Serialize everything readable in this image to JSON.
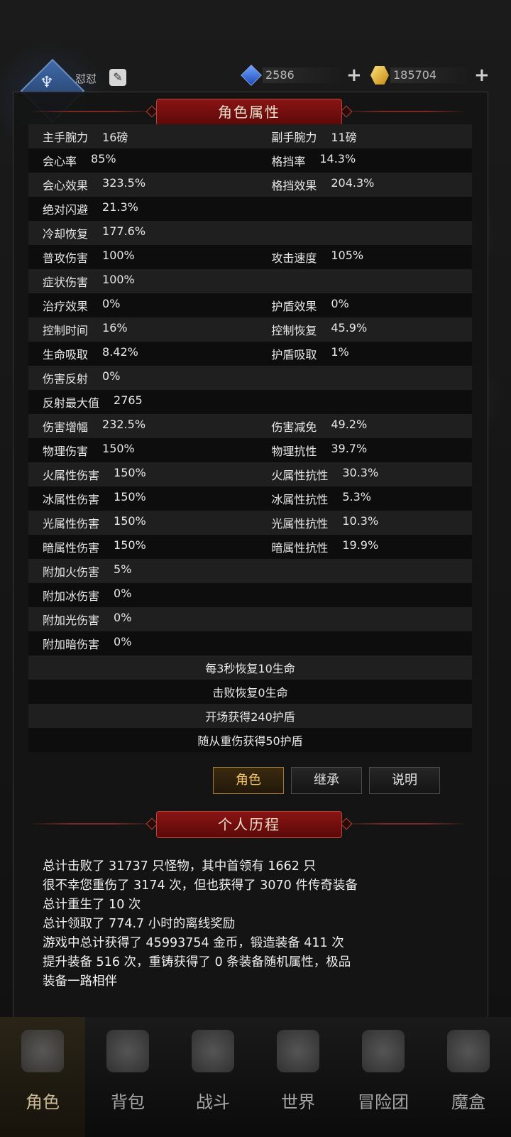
{
  "header": {
    "player_name": "怼怼",
    "currencies": [
      {
        "icon": "blue-gem-icon",
        "value": "2586"
      },
      {
        "icon": "gold-crystal-icon",
        "value": "185704"
      }
    ]
  },
  "attributes_panel": {
    "title": "角色属性",
    "rows": [
      {
        "l_label": "主手腕力",
        "l_value": "16磅",
        "r_label": "副手腕力",
        "r_value": "11磅"
      },
      {
        "l_label": "会心率",
        "l_value": "85%",
        "r_label": "格挡率",
        "r_value": "14.3%"
      },
      {
        "l_label": "会心效果",
        "l_value": "323.5%",
        "r_label": "格挡效果",
        "r_value": "204.3%"
      },
      {
        "l_label": "绝对闪避",
        "l_value": "21.3%",
        "r_label": "",
        "r_value": ""
      },
      {
        "l_label": "冷却恢复",
        "l_value": "177.6%",
        "r_label": "",
        "r_value": ""
      },
      {
        "l_label": "普攻伤害",
        "l_value": "100%",
        "r_label": "攻击速度",
        "r_value": "105%"
      },
      {
        "l_label": "症状伤害",
        "l_value": "100%",
        "r_label": "",
        "r_value": ""
      },
      {
        "l_label": "治疗效果",
        "l_value": "0%",
        "r_label": "护盾效果",
        "r_value": "0%"
      },
      {
        "l_label": "控制时间",
        "l_value": "16%",
        "r_label": "控制恢复",
        "r_value": "45.9%"
      },
      {
        "l_label": "生命吸取",
        "l_value": "8.42%",
        "r_label": "护盾吸取",
        "r_value": "1%"
      },
      {
        "l_label": "伤害反射",
        "l_value": "0%",
        "r_label": "",
        "r_value": ""
      },
      {
        "l_label": "反射最大值",
        "l_value": "2765",
        "r_label": "",
        "r_value": ""
      },
      {
        "l_label": "伤害增幅",
        "l_value": "232.5%",
        "r_label": "伤害减免",
        "r_value": "49.2%"
      },
      {
        "l_label": "物理伤害",
        "l_value": "150%",
        "r_label": "物理抗性",
        "r_value": "39.7%"
      },
      {
        "l_label": "火属性伤害",
        "l_value": "150%",
        "r_label": "火属性抗性",
        "r_value": "30.3%"
      },
      {
        "l_label": "冰属性伤害",
        "l_value": "150%",
        "r_label": "冰属性抗性",
        "r_value": "5.3%"
      },
      {
        "l_label": "光属性伤害",
        "l_value": "150%",
        "r_label": "光属性抗性",
        "r_value": "10.3%"
      },
      {
        "l_label": "暗属性伤害",
        "l_value": "150%",
        "r_label": "暗属性抗性",
        "r_value": "19.9%"
      },
      {
        "l_label": "附加火伤害",
        "l_value": "5%",
        "r_label": "",
        "r_value": ""
      },
      {
        "l_label": "附加冰伤害",
        "l_value": "0%",
        "r_label": "",
        "r_value": ""
      },
      {
        "l_label": "附加光伤害",
        "l_value": "0%",
        "r_label": "",
        "r_value": ""
      },
      {
        "l_label": "附加暗伤害",
        "l_value": "0%",
        "r_label": "",
        "r_value": ""
      }
    ],
    "effects": [
      "每3秒恢复10生命",
      "击败恢复0生命",
      "开场获得240护盾",
      "随从重伤获得50护盾"
    ]
  },
  "tabs": {
    "role": "角色",
    "inherit": "继承",
    "info": "说明"
  },
  "history": {
    "title": "个人历程",
    "lines": [
      "总计击败了 31737 只怪物，其中首领有 1662 只",
      "很不幸您重伤了 3174 次，但也获得了 3070 件传奇装备",
      "总计重生了 10 次",
      "总计领取了 774.7 小时的离线奖励",
      "游戏中总计获得了 45993754 金币，锻造装备 411 次",
      "提升装备 516 次，重铸获得了 0 条装备随机属性，极品",
      "装备一路相伴"
    ]
  },
  "nav": {
    "items": [
      {
        "label": "角色",
        "icon": "helmet-icon"
      },
      {
        "label": "背包",
        "icon": "backpack-icon"
      },
      {
        "label": "战斗",
        "icon": "swords-icon"
      },
      {
        "label": "世界",
        "icon": "scroll-map-icon"
      },
      {
        "label": "冒险团",
        "icon": "castle-icon"
      },
      {
        "label": "魔盒",
        "icon": "magic-box-icon"
      }
    ]
  },
  "colors": {
    "banner_red": "#8a1414",
    "active_gold": "#f3c26a"
  }
}
